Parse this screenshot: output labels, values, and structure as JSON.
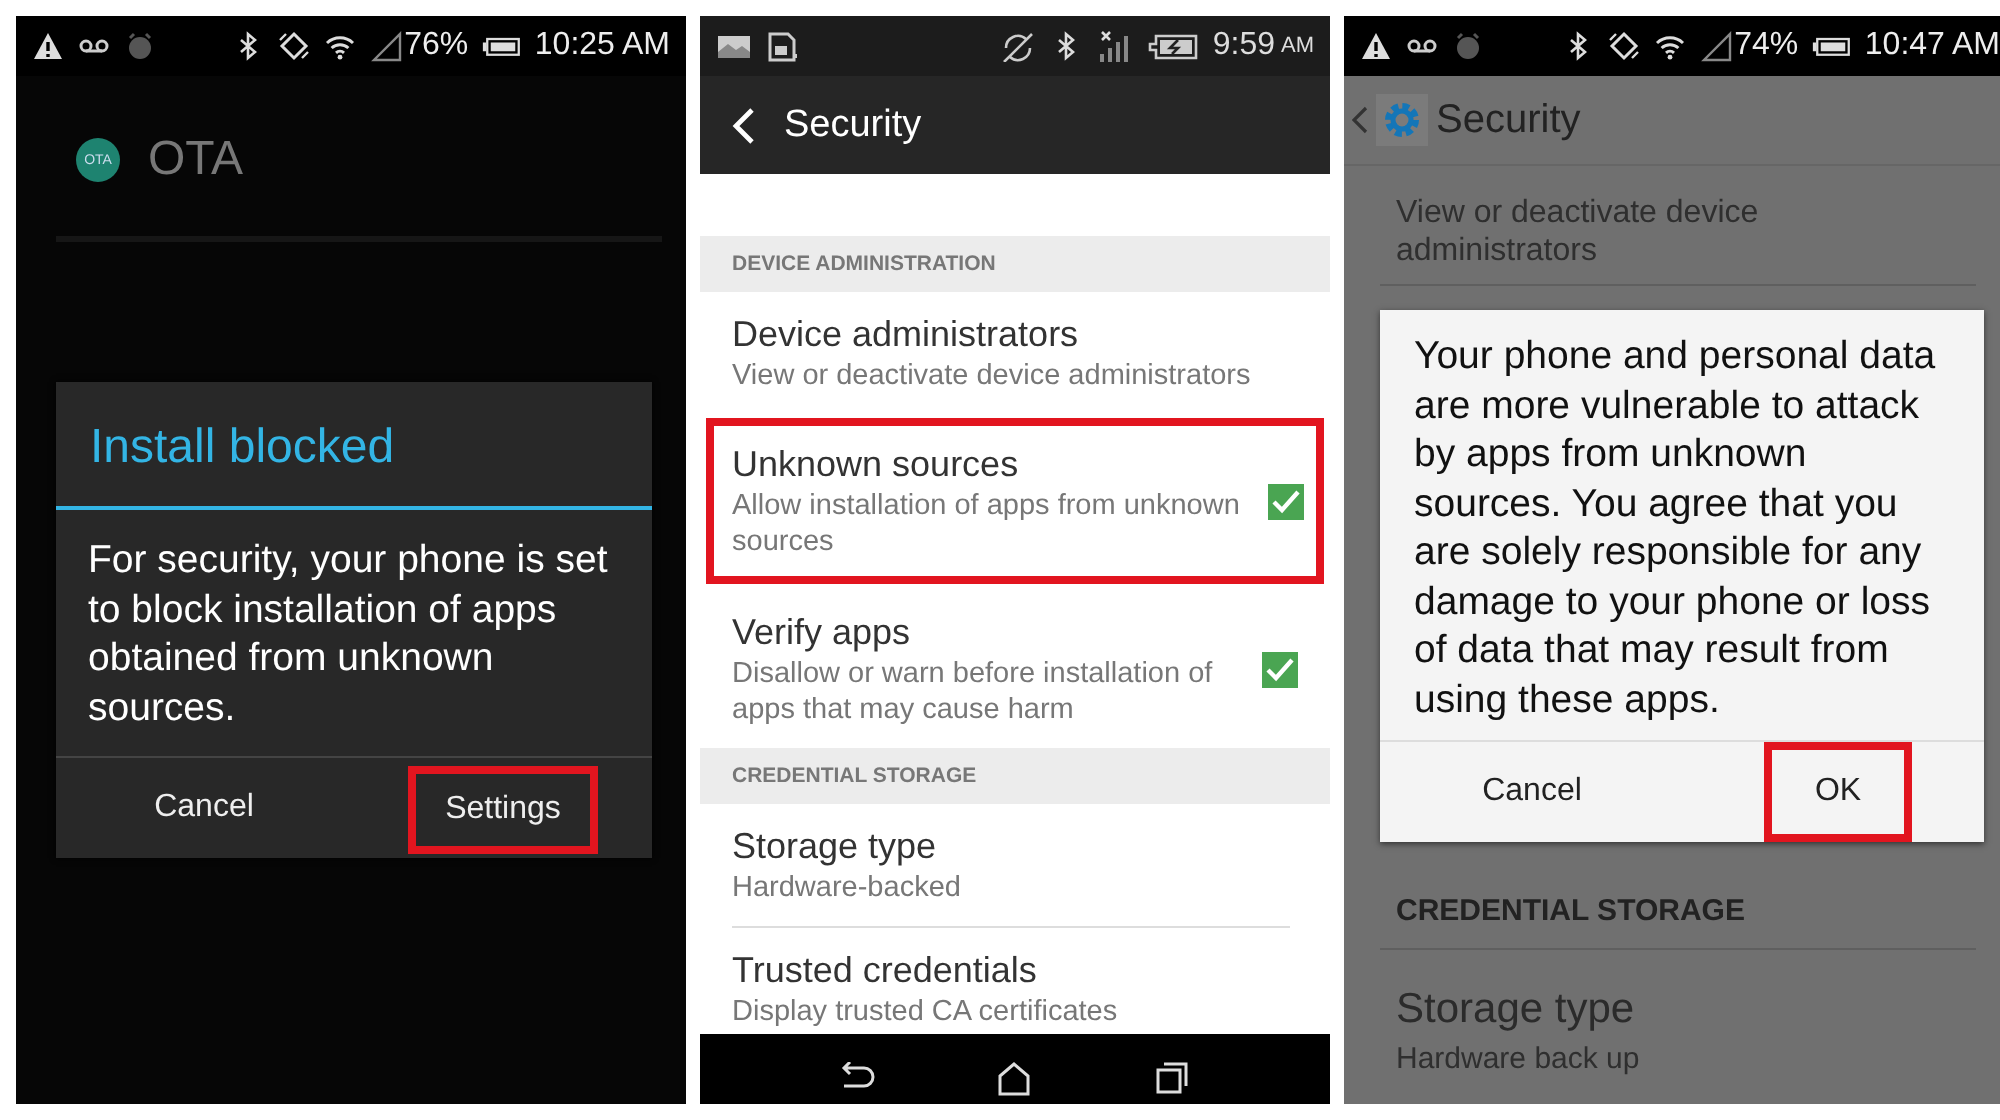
{
  "ota_screen": {
    "status_bar": {
      "battery": "76%",
      "time": "10:25 AM"
    },
    "app": {
      "icon_text": "OTA",
      "title": "OTA"
    },
    "dialog": {
      "title": "Install blocked",
      "message": "For security, your phone is set to block installation of apps obtained from unknown sources.",
      "buttons": [
        {
          "label": "Cancel",
          "highlighted": false
        },
        {
          "label": "Settings",
          "highlighted": true
        }
      ]
    }
  },
  "security_screen": {
    "status_bar": {
      "time": "9:59",
      "period": "AM"
    },
    "title": "Security",
    "sections": [
      {
        "header": "DEVICE ADMINISTRATION",
        "items": [
          {
            "kind": "link",
            "title": "Device administrators",
            "summary": "View or deactivate device administrators",
            "highlighted": false
          },
          {
            "kind": "checkbox",
            "title": "Unknown sources",
            "summary": "Allow installation of apps from unknown sources",
            "checked": true,
            "highlighted": true
          },
          {
            "kind": "checkbox",
            "title": "Verify apps",
            "summary": "Disallow or warn before installation of apps that may cause harm",
            "checked": true,
            "highlighted": false
          }
        ]
      },
      {
        "header": "CREDENTIAL STORAGE",
        "items": [
          {
            "kind": "link",
            "title": "Storage type",
            "summary": "Hardware-backed",
            "highlighted": false
          },
          {
            "kind": "link",
            "title": "Trusted credentials",
            "summary": "Display trusted CA certificates",
            "highlighted": false
          }
        ]
      }
    ]
  },
  "warning_screen": {
    "status_bar": {
      "battery": "74%",
      "time": "10:47 AM"
    },
    "title": "Security",
    "background_item": {
      "summary": "View or deactivate device administrators"
    },
    "dialog": {
      "message": "Your phone and personal data are more vulnerable to attack by apps from unknown sources. You agree that you are solely responsible for any damage to your phone or loss of data that may result from using these apps.",
      "buttons": [
        {
          "label": "Cancel",
          "highlighted": false
        },
        {
          "label": "OK",
          "highlighted": true
        }
      ]
    },
    "section": {
      "header": "CREDENTIAL STORAGE",
      "items": [
        {
          "title": "Storage type",
          "summary": "Hardware back up"
        }
      ]
    }
  }
}
